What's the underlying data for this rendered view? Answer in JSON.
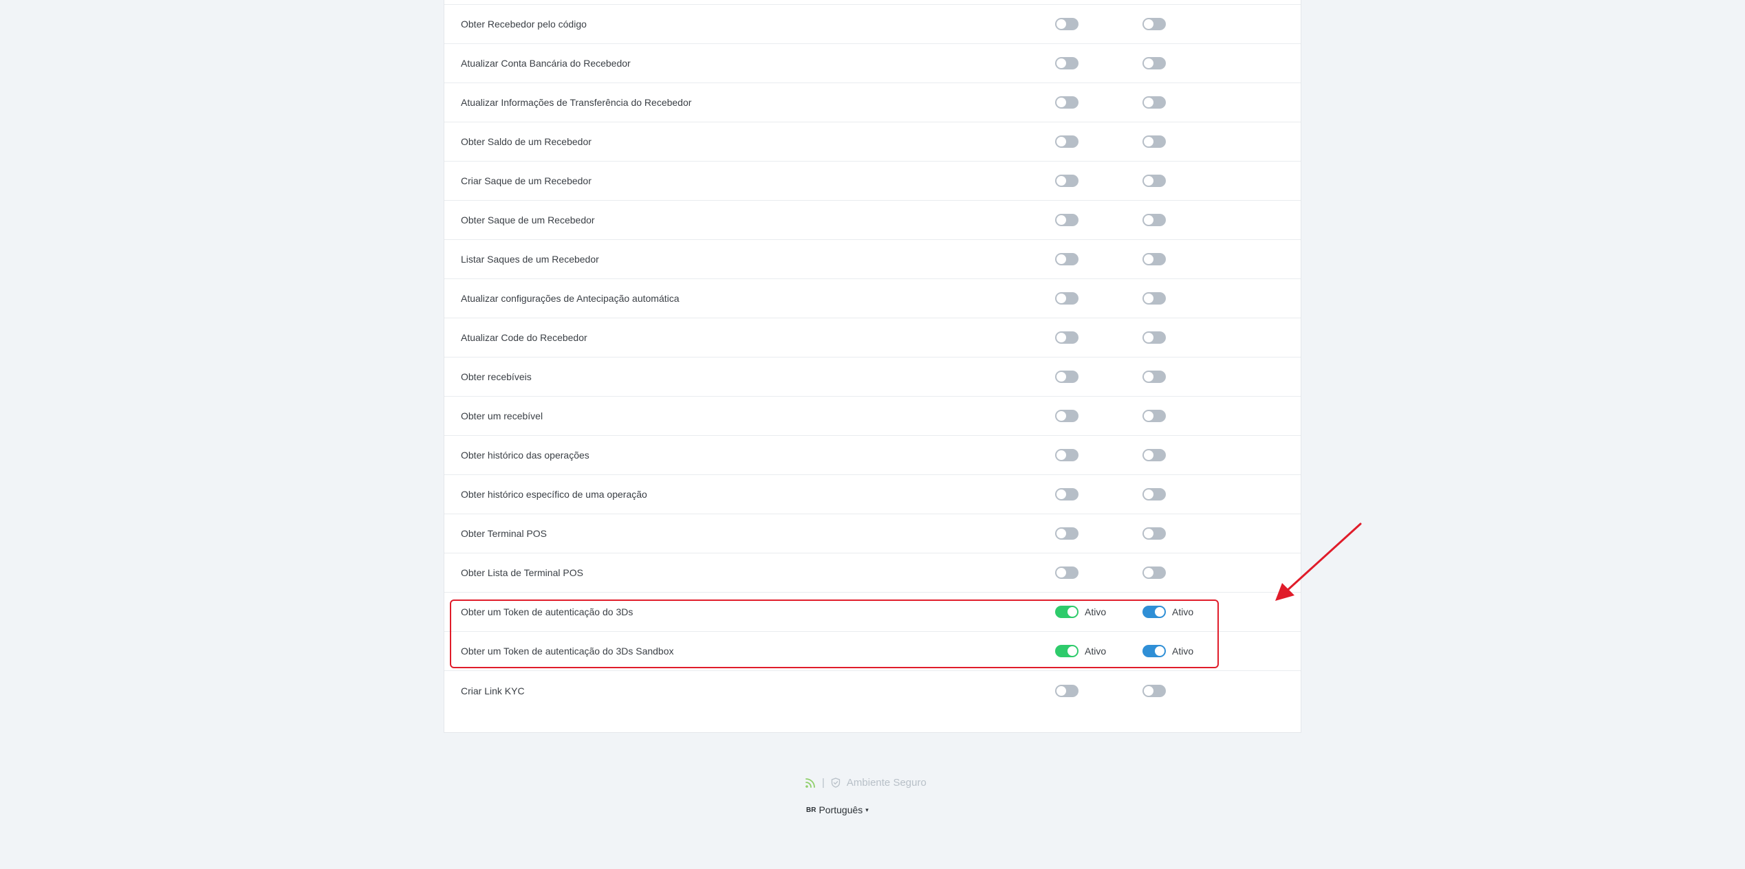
{
  "rows": [
    {
      "label": "Obter Recebedor pelo código",
      "toggle1": false,
      "toggle2": false,
      "status1": "",
      "status2": ""
    },
    {
      "label": "Atualizar Conta Bancária do Recebedor",
      "toggle1": false,
      "toggle2": false,
      "status1": "",
      "status2": ""
    },
    {
      "label": "Atualizar Informações de Transferência do Recebedor",
      "toggle1": false,
      "toggle2": false,
      "status1": "",
      "status2": ""
    },
    {
      "label": "Obter Saldo de um Recebedor",
      "toggle1": false,
      "toggle2": false,
      "status1": "",
      "status2": ""
    },
    {
      "label": "Criar Saque de um Recebedor",
      "toggle1": false,
      "toggle2": false,
      "status1": "",
      "status2": ""
    },
    {
      "label": "Obter Saque de um Recebedor",
      "toggle1": false,
      "toggle2": false,
      "status1": "",
      "status2": ""
    },
    {
      "label": "Listar Saques de um Recebedor",
      "toggle1": false,
      "toggle2": false,
      "status1": "",
      "status2": ""
    },
    {
      "label": "Atualizar configurações de Antecipação automática",
      "toggle1": false,
      "toggle2": false,
      "status1": "",
      "status2": ""
    },
    {
      "label": "Atualizar Code do Recebedor",
      "toggle1": false,
      "toggle2": false,
      "status1": "",
      "status2": ""
    },
    {
      "label": "Obter recebíveis",
      "toggle1": false,
      "toggle2": false,
      "status1": "",
      "status2": ""
    },
    {
      "label": "Obter um recebível",
      "toggle1": false,
      "toggle2": false,
      "status1": "",
      "status2": ""
    },
    {
      "label": "Obter histórico das operações",
      "toggle1": false,
      "toggle2": false,
      "status1": "",
      "status2": ""
    },
    {
      "label": "Obter histórico específico de uma operação",
      "toggle1": false,
      "toggle2": false,
      "status1": "",
      "status2": ""
    },
    {
      "label": "Obter Terminal POS",
      "toggle1": false,
      "toggle2": false,
      "status1": "",
      "status2": ""
    },
    {
      "label": "Obter Lista de Terminal POS",
      "toggle1": false,
      "toggle2": false,
      "status1": "",
      "status2": ""
    },
    {
      "label": "Obter um Token de autenticação do 3Ds",
      "toggle1": true,
      "toggle2": true,
      "status1": "Ativo",
      "status2": "Ativo"
    },
    {
      "label": "Obter um Token de autenticação do 3Ds Sandbox",
      "toggle1": true,
      "toggle2": true,
      "status1": "Ativo",
      "status2": "Ativo"
    },
    {
      "label": "Criar Link KYC",
      "toggle1": false,
      "toggle2": false,
      "status1": "",
      "status2": ""
    }
  ],
  "footer": {
    "separator": "|",
    "secure_label": "Ambiente Seguro",
    "language_flag": "BR",
    "language_label": "Português",
    "language_caret": "▾"
  },
  "colors": {
    "toggle_on_column1": "#2ecb6b",
    "toggle_on_column2": "#2f8fd6",
    "toggle_off": "#b6bec7",
    "highlight": "#e01c2a"
  }
}
